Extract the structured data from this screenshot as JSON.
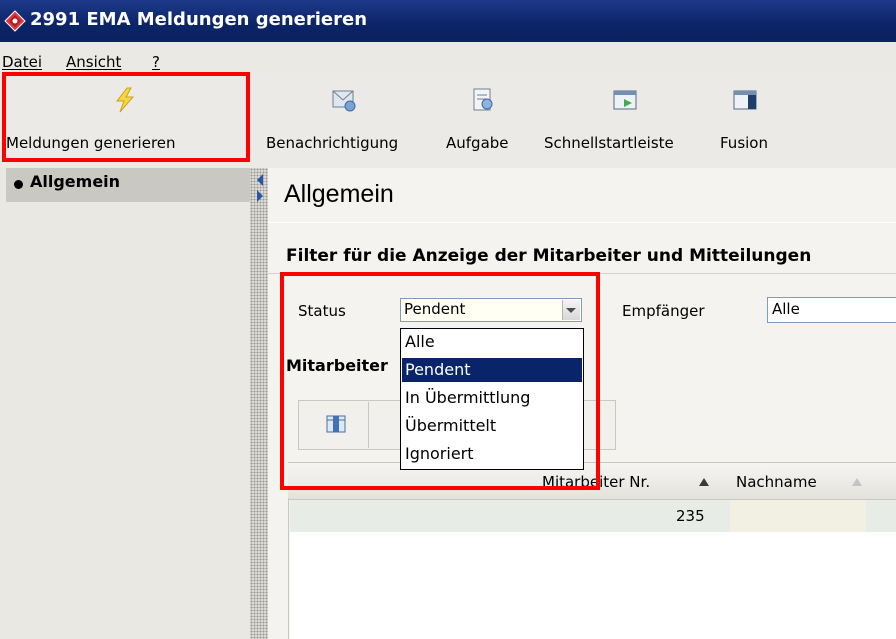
{
  "window": {
    "title": "2991 EMA Meldungen generieren"
  },
  "menu": {
    "items": [
      "Datei",
      "Ansicht",
      "?"
    ]
  },
  "toolbar": {
    "generate_label": "Meldungen generieren",
    "notification_label": "Benachrichtigung",
    "task_label": "Aufgabe",
    "quicklaunch_label": "Schnellstartleiste",
    "fusion_label": "Fusion"
  },
  "nav": {
    "items": [
      {
        "label": "Allgemein"
      }
    ]
  },
  "main": {
    "title": "Allgemein",
    "filter_section_title": "Filter für die Anzeige der Mitarbeiter und Mitteilungen",
    "status_label": "Status",
    "status_value": "Pendent",
    "status_options": [
      "Alle",
      "Pendent",
      "In Übermittlung",
      "Übermittelt",
      "Ignoriert"
    ],
    "recipient_label": "Empfänger",
    "recipient_value": "Alle",
    "employees_section_label": "Mitarbeiter",
    "grid": {
      "columns": [
        "Mitarbeiter Nr.",
        "Nachname"
      ],
      "rows": [
        {
          "nr": "235",
          "name": ""
        }
      ]
    }
  },
  "colors": {
    "title_bar": "#0b2467",
    "selection": "#0a246a",
    "highlight": "#ff0000"
  }
}
